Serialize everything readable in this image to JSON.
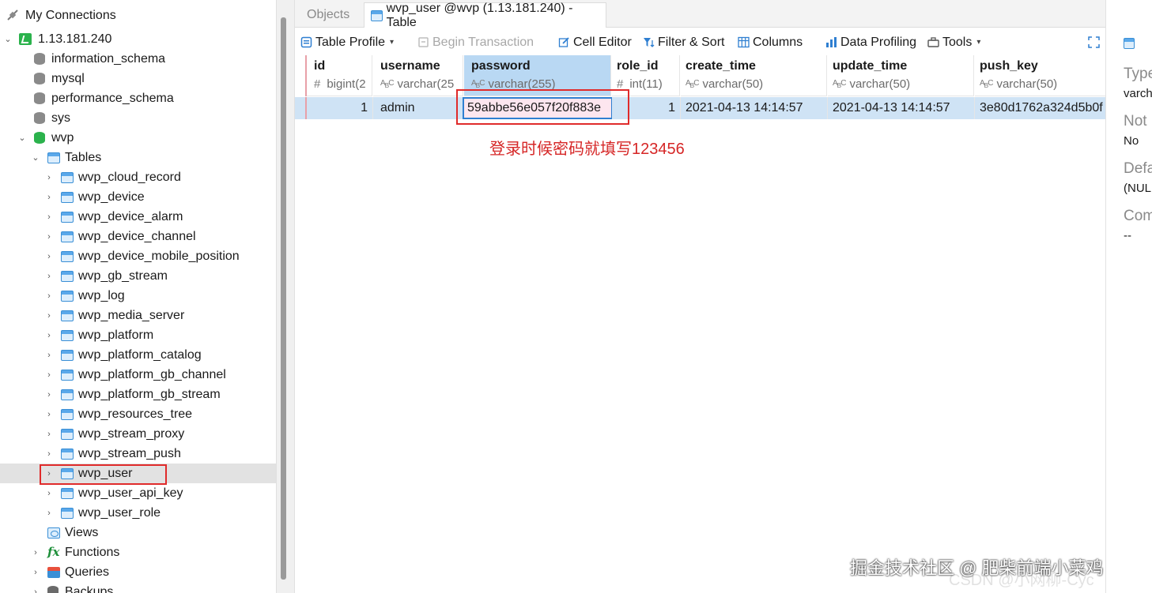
{
  "navigator": {
    "root_label": "My Connections",
    "connection": "1.13.181.240",
    "databases": [
      "information_schema",
      "mysql",
      "performance_schema",
      "sys",
      "wvp"
    ],
    "tables_label": "Tables",
    "tables": [
      "wvp_cloud_record",
      "wvp_device",
      "wvp_device_alarm",
      "wvp_device_channel",
      "wvp_device_mobile_position",
      "wvp_gb_stream",
      "wvp_log",
      "wvp_media_server",
      "wvp_platform",
      "wvp_platform_catalog",
      "wvp_platform_gb_channel",
      "wvp_platform_gb_stream",
      "wvp_resources_tree",
      "wvp_stream_proxy",
      "wvp_stream_push",
      "wvp_user",
      "wvp_user_api_key",
      "wvp_user_role"
    ],
    "selected_table": "wvp_user",
    "views_label": "Views",
    "functions_label": "Functions",
    "queries_label": "Queries",
    "backups_label": "Backups"
  },
  "tabs": [
    {
      "label": "Objects"
    },
    {
      "label": "wvp_user @wvp (1.13.181.240) - Table"
    }
  ],
  "toolbar": {
    "table_profile": "Table Profile",
    "begin_transaction": "Begin Transaction",
    "cell_editor": "Cell Editor",
    "filter_sort": "Filter & Sort",
    "columns": "Columns",
    "data_profiling": "Data Profiling",
    "tools": "Tools"
  },
  "grid": {
    "columns": [
      {
        "name": "id",
        "type": "bigint(2"
      },
      {
        "name": "username",
        "type": "varchar(25"
      },
      {
        "name": "password",
        "type": "varchar(255)"
      },
      {
        "name": "role_id",
        "type": "int(11)"
      },
      {
        "name": "create_time",
        "type": "varchar(50)"
      },
      {
        "name": "update_time",
        "type": "varchar(50)"
      },
      {
        "name": "push_key",
        "type": "varchar(50)"
      }
    ],
    "rows": [
      {
        "id": "1",
        "username": "admin",
        "password": "59abbe56e057f20f883e",
        "role_id": "1",
        "create_time": "2021-04-13 14:14:57",
        "update_time": "2021-04-13 14:14:57",
        "push_key": "3e80d1762a324d5b0f"
      }
    ]
  },
  "annotation": "登录时候密码就填写123456",
  "properties": {
    "type_label": "Type",
    "type_value": "varch",
    "not_null_label": "Not",
    "not_null_value": "No",
    "default_label": "Defa",
    "default_value": "(NUL",
    "comment_label": "Com",
    "comment_value": "--"
  },
  "watermark": "掘金技术社区 @ 肥柴前端小菜鸡",
  "watermark_secondary": "CSDN @小网柳-Cyc",
  "colors": {
    "selection": "#cfe3f5",
    "header_selected": "#b9d8f3",
    "highlight_box": "#e02b2b",
    "annotation": "#d62626"
  }
}
